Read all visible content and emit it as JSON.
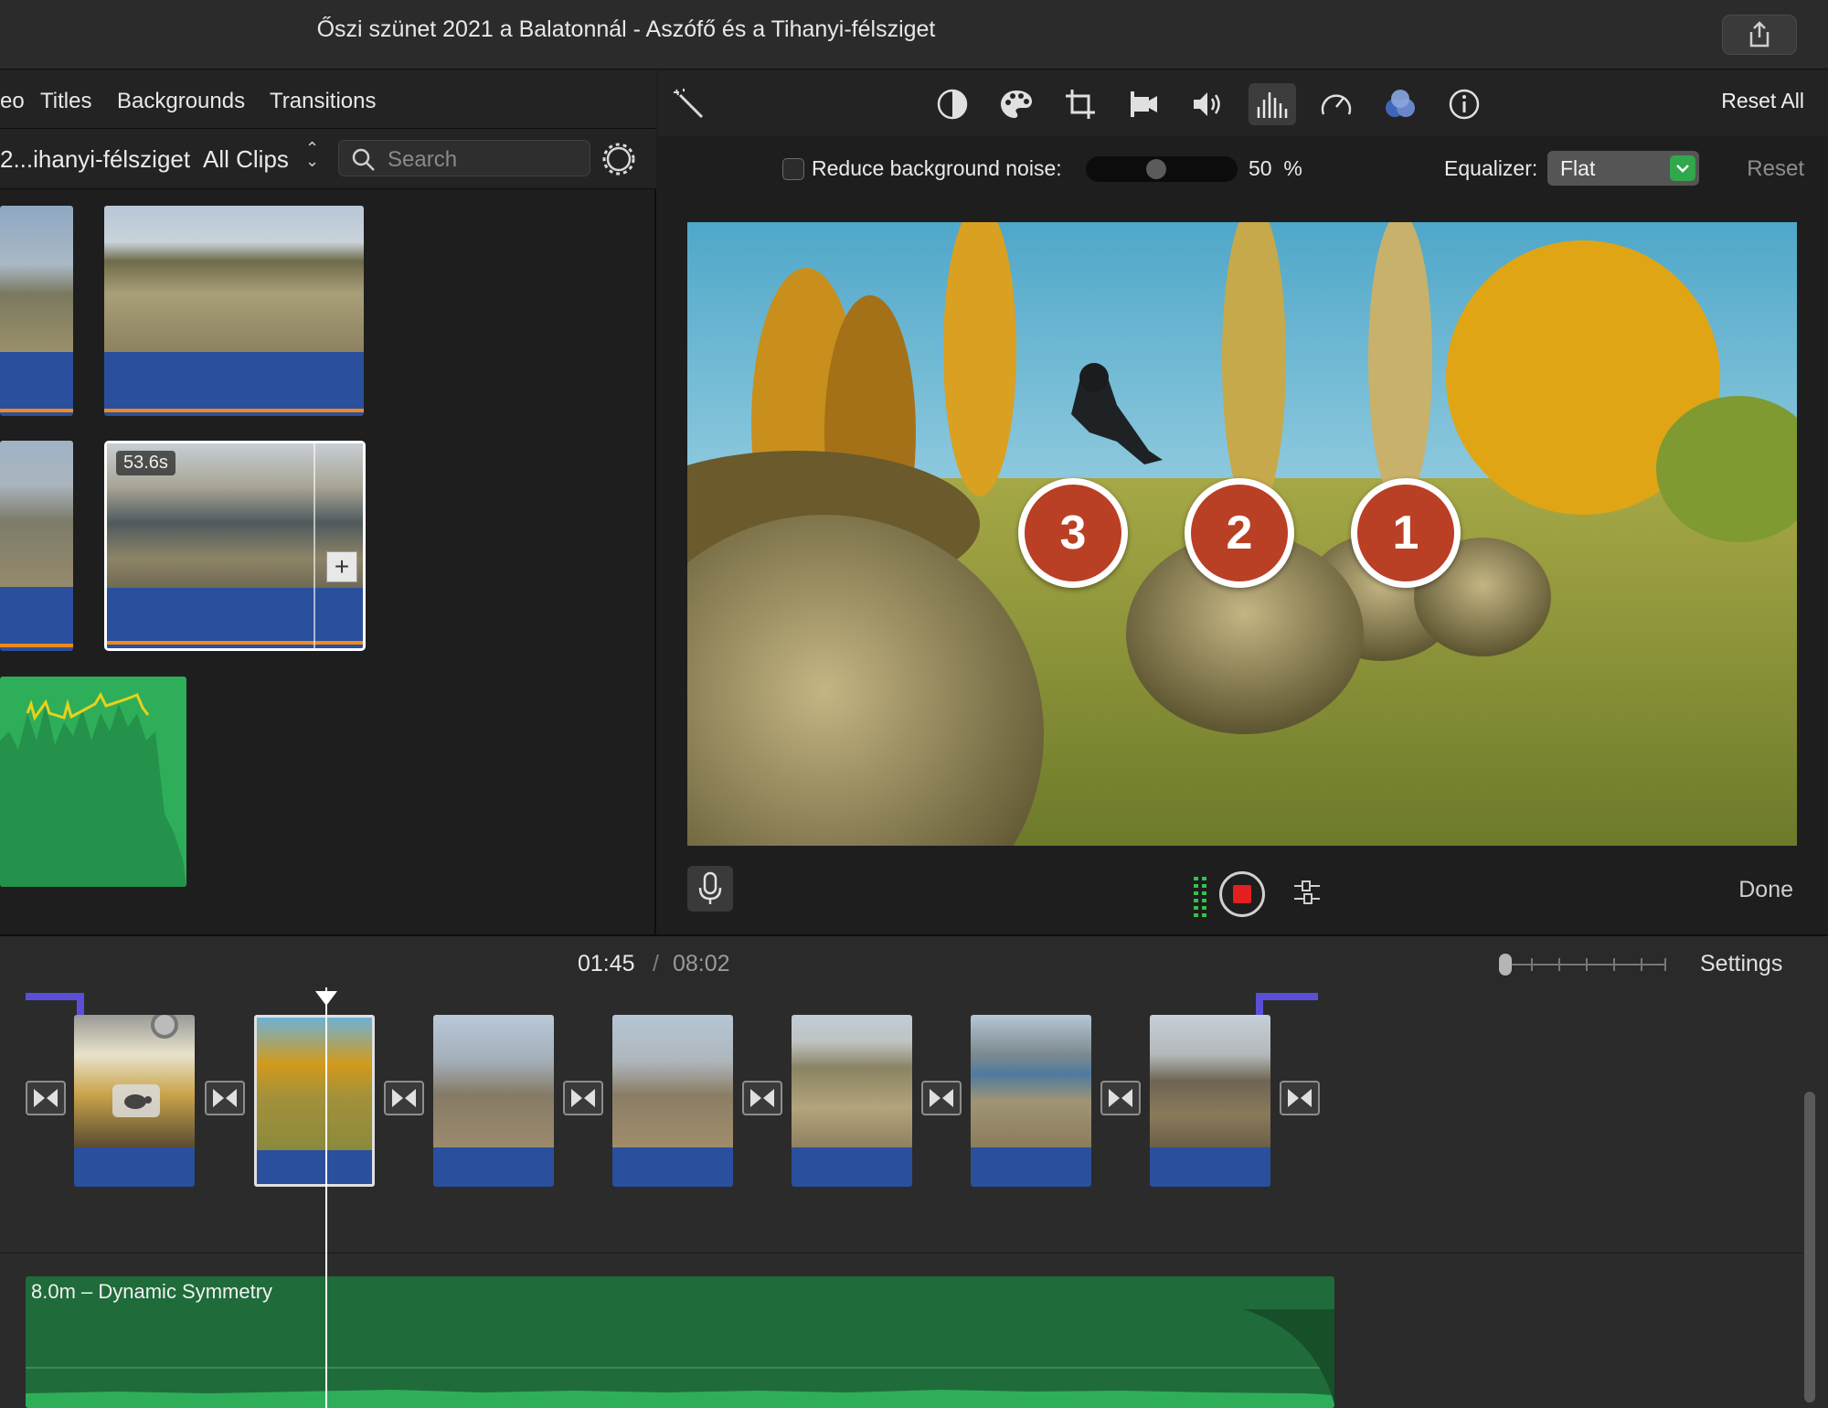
{
  "window": {
    "title": "Őszi szünet 2021 a Balatonnál - Aszófő és a Tihanyi-félsziget"
  },
  "browser": {
    "tabs": [
      "eo",
      "Titles",
      "Backgrounds",
      "Transitions"
    ],
    "library_name": "2...ihanyi-félsziget",
    "filter_label": "All Clips",
    "search_placeholder": "Search",
    "selected_clip_duration": "53.6s"
  },
  "inspector": {
    "reset_all_label": "Reset All",
    "reduce_noise_label": "Reduce background noise:",
    "reduce_noise_checked": false,
    "noise_value": "50",
    "noise_unit": "%",
    "equalizer_label": "Equalizer:",
    "equalizer_value": "Flat",
    "reset_label": "Reset",
    "active_tool": "audio-equalizer-icon"
  },
  "viewer": {
    "callouts": [
      "3",
      "2",
      "1"
    ],
    "done_label": "Done"
  },
  "timeline": {
    "current_time": "01:45",
    "separator": "/",
    "total_time": "08:02",
    "settings_label": "Settings",
    "music_clip_label": "8.0m – Dynamic Symmetry"
  },
  "colors": {
    "audio_blue": "#2a4f9c",
    "music_green": "#1f6b3a",
    "callout_red": "#b93f25",
    "accent_purple": "#5a4fd6",
    "waveform_orange": "#f08a1c"
  }
}
